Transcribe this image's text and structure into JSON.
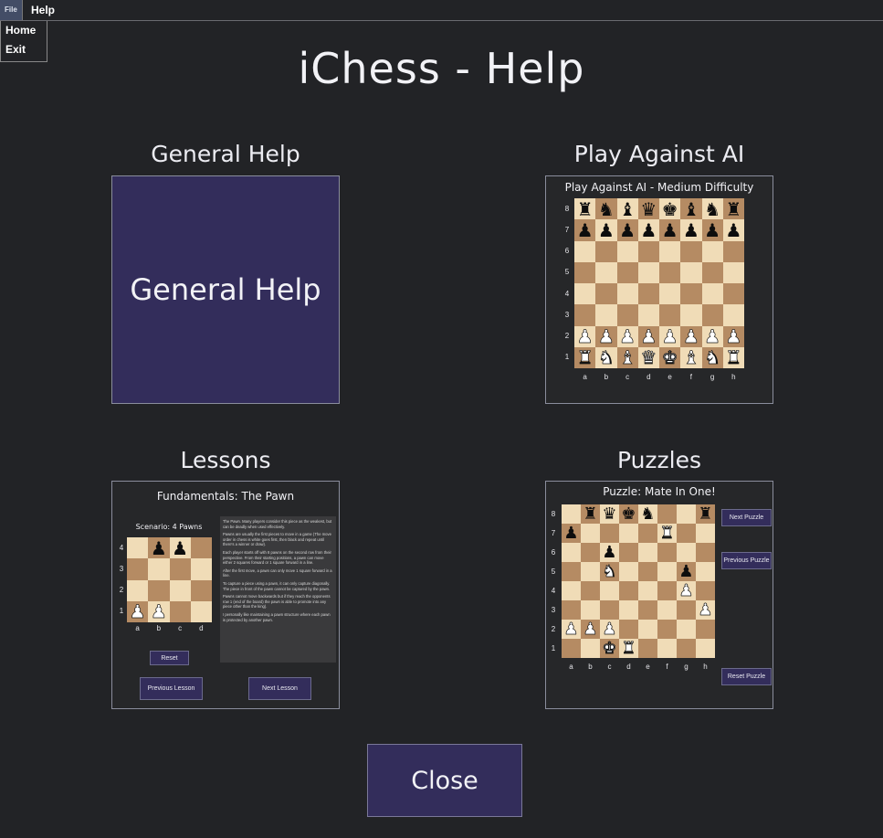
{
  "menubar": {
    "file": "File",
    "help": "Help"
  },
  "file_menu": {
    "items": [
      "Home",
      "Exit"
    ]
  },
  "title": "iChess - Help",
  "sections": {
    "general": {
      "heading": "General Help",
      "button_label": "General Help"
    },
    "ai": {
      "heading": "Play Against AI",
      "panel_title": "Play Against AI - Medium Difficulty",
      "board": [
        "rnbqkbnr",
        "pppppppp",
        "........",
        "........",
        "........",
        "........",
        "PPPPPPPP",
        "RNBQKBNR"
      ],
      "ranks": [
        "8",
        "7",
        "6",
        "5",
        "4",
        "3",
        "2",
        "1"
      ],
      "files": [
        "a",
        "b",
        "c",
        "d",
        "e",
        "f",
        "g",
        "h"
      ]
    },
    "lessons": {
      "heading": "Lessons",
      "panel_title": "Fundamentals: The Pawn",
      "scenario": "Scenario: 4 Pawns",
      "board": [
        ".pp.",
        "....",
        "....",
        "PP.."
      ],
      "ranks": [
        "4",
        "3",
        "2",
        "1"
      ],
      "files": [
        "a",
        "b",
        "c",
        "d"
      ],
      "reset_label": "Reset",
      "prev_label": "Previous Lesson",
      "next_label": "Next Lesson",
      "text": [
        "The Pawn. Many players consider this piece as the weakest, but can be deadly when used effectively.",
        "Pawns are usually the first pieces to move in a game (The move order in chess is white goes first, then black and repeat until there's a winner or draw).",
        "Each player starts off with 8 pawns on the second row from their perspective. From their starting positions, a pawn can move either 2 squares forward or 1 square forward in a line.",
        "After the first move, a pawn can only move 1 square forward in a line.",
        "To capture a piece using a pawn, it can only capture diagonally. The piece in front of the pawn cannot be captured by the pawn.",
        "Pawns cannot move backwards but if they reach the opponents row 1 (end of the board) the pawn is able to promote into any piece other than the king).",
        "I personally like maintaining a pawn structure where each pawn is protected by another pawn."
      ]
    },
    "puzzles": {
      "heading": "Puzzles",
      "panel_title": "Puzzle: Mate In One!",
      "board": [
        ".rqkn..r",
        "p....R..",
        "..p.....",
        "..N...p.",
        "......P.",
        ".......P",
        "PPP.....",
        "..KR...."
      ],
      "ranks": [
        "8",
        "7",
        "6",
        "5",
        "4",
        "3",
        "2",
        "1"
      ],
      "files": [
        "a",
        "b",
        "c",
        "d",
        "e",
        "f",
        "g",
        "h"
      ],
      "next_label": "Next Puzzle",
      "prev_label": "Previous Puzzle",
      "reset_label": "Reset Puzzle"
    }
  },
  "close_label": "Close"
}
